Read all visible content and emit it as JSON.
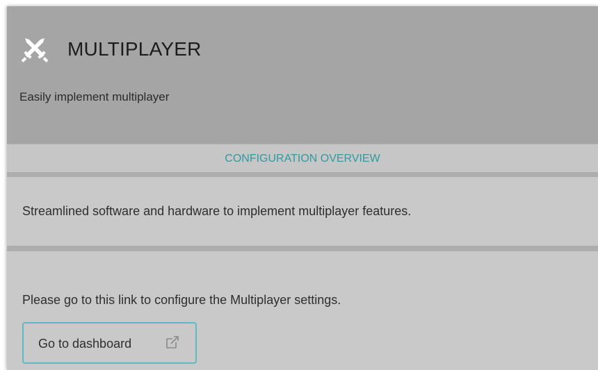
{
  "header": {
    "icon": "crossed-swords-icon",
    "title": "MULTIPLAYER",
    "subtitle": "Easily implement multiplayer"
  },
  "section": {
    "tab_label": "CONFIGURATION OVERVIEW"
  },
  "overview": {
    "description": "Streamlined software and hardware to implement multiplayer features."
  },
  "configure": {
    "instruction": "Please go to this link to configure the Multiplayer settings.",
    "button_label": "Go to dashboard",
    "button_icon": "external-link-icon"
  },
  "colors": {
    "accent": "#2f9aa3",
    "button_border": "#5fb9c0",
    "header_bg": "#a5a5a5",
    "panel_bg": "#c9c9c9"
  }
}
